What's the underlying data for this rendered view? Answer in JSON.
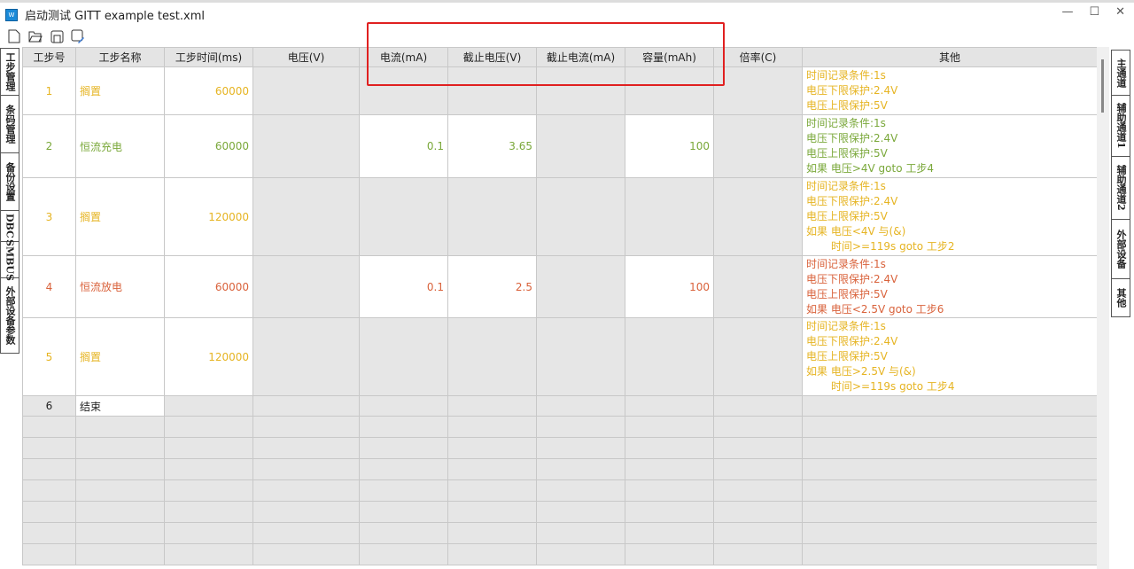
{
  "window": {
    "title": "启动测试 GITT example test.xml",
    "icon": "app-icon"
  },
  "toolbar": [
    "new-file-icon",
    "open-folder-icon",
    "save-icon",
    "save-as-icon"
  ],
  "left_tabs": [
    "工步管理",
    "条码管理",
    "备份设置",
    "DBC",
    "SMBUS",
    "外部设备参数"
  ],
  "right_tabs": [
    "主通道",
    "辅助通道1",
    "辅助通道2",
    "外部设备",
    "其他"
  ],
  "colors": {
    "rest": "#e6b422",
    "charge": "#7aa83a",
    "discharge": "#d9623b",
    "highlight": "#e02020"
  },
  "columns": [
    "工步号",
    "工步名称",
    "工步时间(ms)",
    "电压(V)",
    "电流(mA)",
    "截止电压(V)",
    "截止电流(mA)",
    "容量(mAh)",
    "倍率(C)",
    "其他"
  ],
  "rows": [
    {
      "no": "1",
      "name": "搁置",
      "time": "60000",
      "voltage": "",
      "current": "",
      "cutoff_v": "",
      "cutoff_i": "",
      "capacity": "",
      "rate": "",
      "color": "rest",
      "other": [
        "时间记录条件:1s",
        "电压下限保护:2.4V",
        "电压上限保护:5V"
      ]
    },
    {
      "no": "2",
      "name": "恒流充电",
      "time": "60000",
      "voltage": "",
      "current": "0.1",
      "cutoff_v": "3.65",
      "cutoff_i": "",
      "capacity": "100",
      "rate": "",
      "color": "charge",
      "other": [
        "时间记录条件:1s",
        "电压下限保护:2.4V",
        "电压上限保护:5V",
        "如果 电压>4V goto 工步4"
      ]
    },
    {
      "no": "3",
      "name": "搁置",
      "time": "120000",
      "voltage": "",
      "current": "",
      "cutoff_v": "",
      "cutoff_i": "",
      "capacity": "",
      "rate": "",
      "color": "rest",
      "other": [
        "时间记录条件:1s",
        "电压下限保护:2.4V",
        "电压上限保护:5V",
        "如果 电压<4V 与(&)",
        "时间>=119s goto 工步2"
      ]
    },
    {
      "no": "4",
      "name": "恒流放电",
      "time": "60000",
      "voltage": "",
      "current": "0.1",
      "cutoff_v": "2.5",
      "cutoff_i": "",
      "capacity": "100",
      "rate": "",
      "color": "discharge",
      "other": [
        "时间记录条件:1s",
        "电压下限保护:2.4V",
        "电压上限保护:5V",
        "如果 电压<2.5V goto 工步6"
      ]
    },
    {
      "no": "5",
      "name": "搁置",
      "time": "120000",
      "voltage": "",
      "current": "",
      "cutoff_v": "",
      "cutoff_i": "",
      "capacity": "",
      "rate": "",
      "color": "rest",
      "other": [
        "时间记录条件:1s",
        "电压下限保护:2.4V",
        "电压上限保护:5V",
        "如果 电压>2.5V 与(&)",
        "时间>=119s goto 工步4"
      ]
    },
    {
      "no": "6",
      "name": "结束",
      "time": "",
      "voltage": "",
      "current": "",
      "cutoff_v": "",
      "cutoff_i": "",
      "capacity": "",
      "rate": "",
      "color": "",
      "other": []
    }
  ]
}
